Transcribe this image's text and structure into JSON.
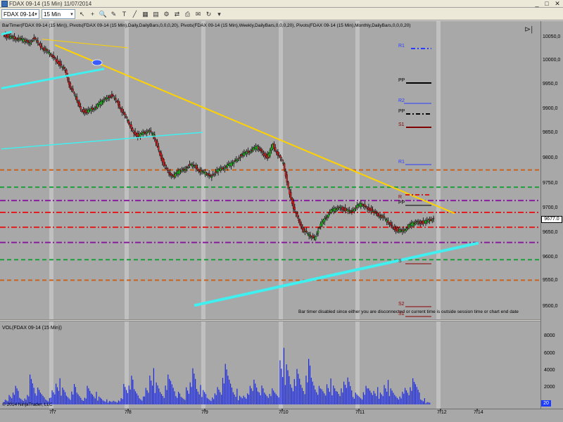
{
  "window": {
    "title": "FDAX 09-14 (15 Min)  11/07/2014",
    "minimize": "_",
    "maximize": "□",
    "close": "✕"
  },
  "toolbar": {
    "instrument": "FDAX 09-14",
    "interval": "15 Min",
    "buttons": [
      "pointer-icon",
      "crosshair-icon",
      "zoom-icon",
      "pencil-icon",
      "text-icon",
      "line-icon",
      "properties-icon",
      "data-box-icon",
      "strategy-icon",
      "chart-trader-icon",
      "print-icon",
      "email-icon",
      "refresh-icon",
      "down-arrow-icon"
    ]
  },
  "indicators_label": "BarTimer(FDAX 09-14 (15 Min)), Pivots(FDAX 09-14 (15 Min),Daily,DailyBars,0,0,0,20), Pivots(FDAX 09-14 (15 Min),Weekly,DailyBars,0,0,0,20), Pivots(FDAX 09-14 (15 Min),Monthly,DailyBars,0,0,0,20)",
  "bartimer_message": "Bar timer disabled since either you are disconnected or current time is outside session time or chart end date",
  "volume_label": "VOL(FDAX 09-14 (15 Min))",
  "copyright": "© 2014 NinjaTrader, LLC",
  "pivot_labels": [
    {
      "text": "R1",
      "color": "#2a3cff"
    },
    {
      "text": "PP",
      "color": "#000000"
    },
    {
      "text": "R2",
      "color": "#2a3cff"
    },
    {
      "text": "PP",
      "color": "#000000"
    },
    {
      "text": "S1",
      "color": "#800000"
    },
    {
      "text": "R1",
      "color": "#2a3cff"
    },
    {
      "text": "R",
      "color": "#8b0000"
    },
    {
      "text": "PP",
      "color": "#000000"
    },
    {
      "text": "S",
      "color": "#8b0000"
    },
    {
      "text": "S2",
      "color": "#8b0000"
    },
    {
      "text": "S1",
      "color": "#8b0000"
    }
  ],
  "price_badge": "9677.0",
  "volume_badge": "20",
  "chart_data": {
    "type": "candlestick",
    "price_axis": {
      "ticks": [
        "10050,0",
        "10000,0",
        "9950,0",
        "9900,0",
        "9850,0",
        "9800,0",
        "9750,0",
        "9700,0",
        "9650,0",
        "9600,0",
        "9550,0",
        "9500,0"
      ],
      "range": [
        9465,
        10090
      ]
    },
    "volume_axis": {
      "ticks": [
        "8000",
        "6000",
        "4000",
        "2000"
      ]
    },
    "x_ticks": [
      "7/7",
      "7/8",
      "7/9",
      "7/10",
      "7/11",
      "7/12",
      "7/14"
    ],
    "last_price": 9677.0,
    "horizontal_levels": [
      {
        "price": 9778,
        "color": "#c8641e",
        "style": "dash"
      },
      {
        "price": 9742,
        "color": "#1e9e3c",
        "style": "dash"
      },
      {
        "price": 9714,
        "color": "#8a1ea0",
        "style": "dashdot"
      },
      {
        "price": 9689,
        "color": "#e01e1e",
        "style": "dashdot"
      },
      {
        "price": 9658,
        "color": "#e01e1e",
        "style": "dashdot"
      },
      {
        "price": 9626,
        "color": "#8a1ea0",
        "style": "dashdot"
      },
      {
        "price": 9590,
        "color": "#1e9e3c",
        "style": "dash"
      },
      {
        "price": 9547,
        "color": "#c8641e",
        "style": "dash"
      }
    ],
    "price_path": [
      10063,
      10058,
      10055,
      10052,
      10049,
      10045,
      10055,
      10040,
      10030,
      10020,
      10012,
      10000,
      9985,
      9950,
      9930,
      9905,
      9900,
      9905,
      9910,
      9920,
      9930,
      9935,
      9920,
      9900,
      9880,
      9860,
      9850,
      9855,
      9860,
      9850,
      9820,
      9790,
      9770,
      9765,
      9775,
      9780,
      9790,
      9785,
      9775,
      9770,
      9765,
      9775,
      9780,
      9785,
      9790,
      9800,
      9810,
      9815,
      9820,
      9825,
      9815,
      9805,
      9830,
      9810,
      9790,
      9740,
      9700,
      9670,
      9650,
      9640,
      9635,
      9660,
      9675,
      9690,
      9695,
      9700,
      9695,
      9690,
      9700,
      9705,
      9700,
      9695,
      9685,
      9680,
      9670,
      9660,
      9652,
      9650,
      9658,
      9665,
      9670,
      9668,
      9672,
      9677
    ],
    "volume_values": [
      600,
      1400,
      2200,
      900,
      1200,
      3800,
      2000,
      1400,
      800,
      1800,
      3100,
      2000,
      1200,
      2600,
      1500,
      800,
      2200,
      1600,
      1000,
      600,
      400,
      500,
      800,
      2600,
      3400,
      1800,
      1000,
      2100,
      4300,
      2600,
      1700,
      3800,
      3000,
      1500,
      900,
      2800,
      4600,
      2300,
      1700,
      900,
      1400,
      2200,
      4800,
      3400,
      2000,
      1100,
      1300,
      2200,
      3400,
      2400,
      1500,
      1900,
      1400,
      7200,
      5100,
      3000,
      4200,
      2700,
      5800,
      3400,
      2200,
      1800,
      3300,
      2400,
      1900,
      2700,
      3700,
      1500,
      1100,
      2200,
      1900,
      2200,
      1500,
      2900,
      1900,
      1300,
      1600,
      2100,
      3100,
      2400,
      800,
      300
    ]
  }
}
